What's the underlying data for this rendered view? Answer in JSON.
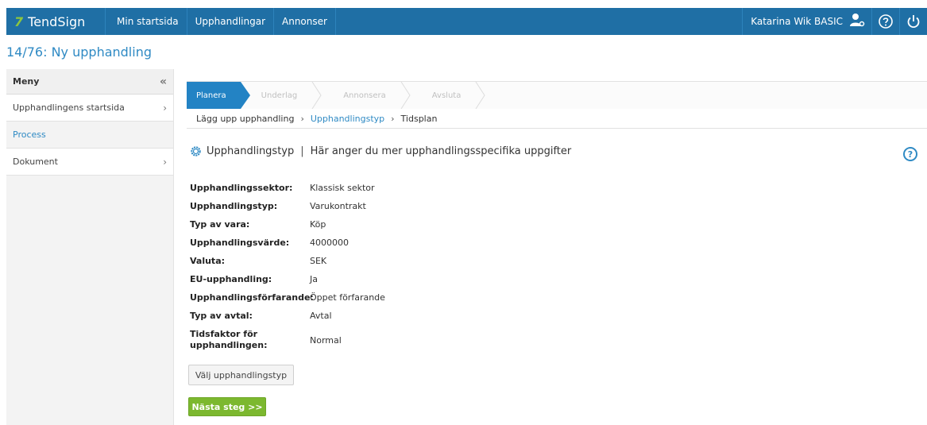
{
  "app": {
    "brand_mark": "7",
    "brand_name": "TendSign"
  },
  "topnav": {
    "items": [
      {
        "label": "Min startsida"
      },
      {
        "label": "Upphandlingar"
      },
      {
        "label": "Annonser"
      }
    ],
    "user_label": "Katarina Wik BASIC",
    "icons": [
      "user-icon",
      "help-icon",
      "power-icon"
    ]
  },
  "page": {
    "title": "14/76: Ny upphandling"
  },
  "sidebar": {
    "heading": "Meny",
    "collapse_glyph": "«",
    "items": [
      {
        "label": "Upphandlingens startsida",
        "chevron": "›"
      },
      {
        "label": "Process",
        "chevron": ""
      },
      {
        "label": "Dokument",
        "chevron": "›"
      }
    ]
  },
  "steps": [
    {
      "label": "Planera",
      "active": true
    },
    {
      "label": "Underlag",
      "active": false
    },
    {
      "label": "Annonsera",
      "active": false
    },
    {
      "label": "Avsluta",
      "active": false
    }
  ],
  "breadcrumb": {
    "items": [
      "Lägg upp upphandling",
      "Upphandlingstyp",
      "Tidsplan"
    ],
    "separator": "›"
  },
  "section": {
    "title": "Upphandlingstyp",
    "separator": "|",
    "description": "Här anger du mer upphandlingsspecifika uppgifter",
    "help_glyph": "?"
  },
  "fields": [
    {
      "label": "Upphandlingssektor:",
      "value": "Klassisk sektor"
    },
    {
      "label": "Upphandlingstyp:",
      "value": "Varukontrakt"
    },
    {
      "label": "Typ av vara:",
      "value": "Köp"
    },
    {
      "label": "Upphandlingsvärde:",
      "value": "4000000"
    },
    {
      "label": "Valuta:",
      "value": "SEK"
    },
    {
      "label": "EU-upphandling:",
      "value": "Ja"
    },
    {
      "label": "Upphandlingsförfarande:",
      "value": "Öppet förfarande"
    },
    {
      "label": "Typ av avtal:",
      "value": "Avtal"
    },
    {
      "label": "Tidsfaktor för upphandlingen:",
      "value": "Normal"
    }
  ],
  "buttons": {
    "select_type": "Välj upphandlingstyp",
    "next_step": "Nästa steg >>"
  },
  "colors": {
    "topbar": "#1f6fa5",
    "accent": "#2f8ac4",
    "active_step": "#2383c4",
    "next_button": "#7cb82f",
    "brand_mark": "#8cc63f"
  }
}
